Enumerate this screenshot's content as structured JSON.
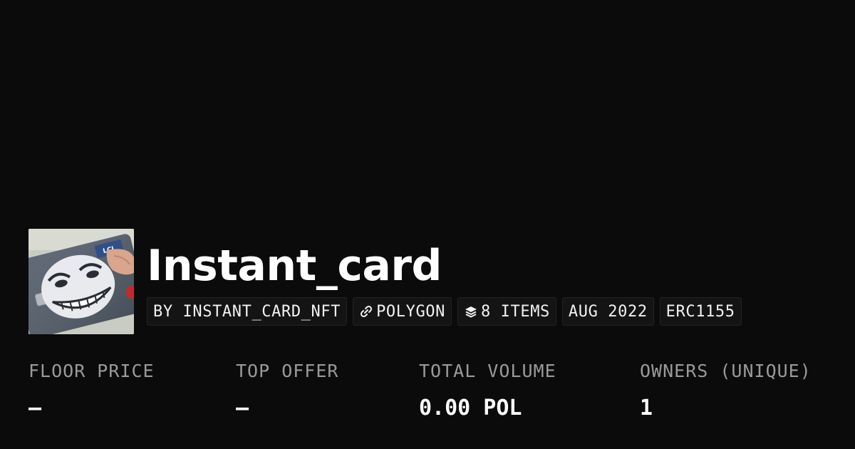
{
  "collection": {
    "title": "Instant_card",
    "image_icon": "trollface-credit-card-image"
  },
  "chips": {
    "creator": "BY INSTANT_CARD_NFT",
    "chain": "POLYGON",
    "chain_icon": "link-icon",
    "items": "8 ITEMS",
    "items_icon": "layers-icon",
    "date": "AUG 2022",
    "standard": "ERC1155"
  },
  "stats": {
    "floor_price": {
      "label": "FLOOR PRICE",
      "value": "–"
    },
    "top_offer": {
      "label": "TOP OFFER",
      "value": "–"
    },
    "total_volume": {
      "label": "TOTAL VOLUME",
      "value": "0.00 POL"
    },
    "owners": {
      "label": "OWNERS (UNIQUE)",
      "value": "1"
    }
  },
  "colors": {
    "background": "#0b0b0b",
    "chip_background": "#141414",
    "label_gray": "#9a9a9a",
    "text": "#ffffff"
  }
}
